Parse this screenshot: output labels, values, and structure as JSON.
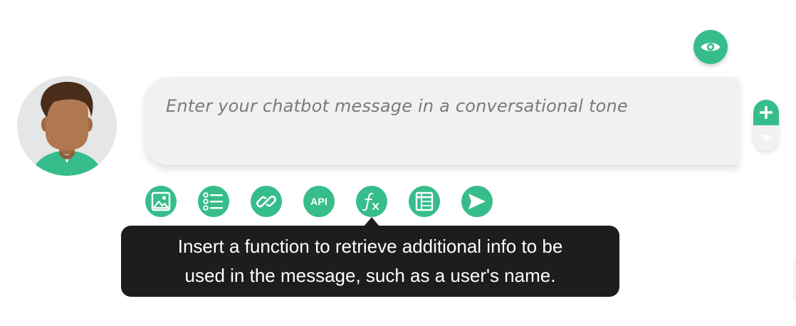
{
  "message": {
    "placeholder": "Enter your chatbot message in a conversational tone"
  },
  "toolbar": {
    "api_label": "API",
    "icons": [
      "image-icon",
      "list-icon",
      "link-icon",
      "api-icon",
      "function-icon",
      "table-icon",
      "send-icon"
    ]
  },
  "tooltip": {
    "line1": "Insert a function to retrieve additional info to be",
    "line2": "used in the message, such as a user's name."
  },
  "icons": {
    "preview": "eye-icon",
    "add": "plus-icon",
    "move_down": "chevron-down-icon"
  },
  "colors": {
    "accent": "#37bd8c",
    "message_bg": "#f1f1f1",
    "placeholder_text": "#7a7a7a",
    "tooltip_bg": "#1d1d1d"
  }
}
